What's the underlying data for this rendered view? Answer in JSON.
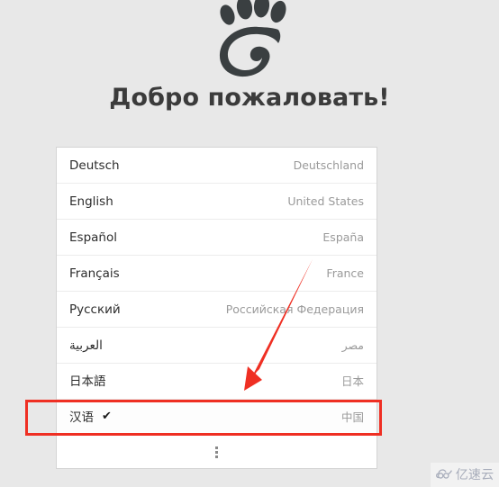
{
  "page": {
    "background_color": "#e8e8e8",
    "logo_name": "gnome-foot-logo",
    "logo_color": "#3a3f41",
    "heading": "Добро пожаловать!"
  },
  "language_list": {
    "rows": [
      {
        "name": "Deutsch",
        "country": "Deutschland",
        "selected": false,
        "rtl": false
      },
      {
        "name": "English",
        "country": "United States",
        "selected": false,
        "rtl": false
      },
      {
        "name": "Español",
        "country": "España",
        "selected": false,
        "rtl": false
      },
      {
        "name": "Français",
        "country": "France",
        "selected": false,
        "rtl": false
      },
      {
        "name": "Русский",
        "country": "Российская Федерация",
        "selected": false,
        "rtl": false
      },
      {
        "name": "العربية",
        "country": "مصر",
        "selected": false,
        "rtl": true
      },
      {
        "name": "日本語",
        "country": "日本",
        "selected": false,
        "rtl": false
      },
      {
        "name": "汉语",
        "country": "中国",
        "selected": true,
        "rtl": false
      }
    ],
    "check_glyph": "✔",
    "more_options": {
      "icon": "vertical-dots-icon",
      "label": ""
    }
  },
  "annotations": {
    "highlight_rect": {
      "color": "#ef2f23",
      "target": "汉语"
    },
    "arrow": {
      "color": "#ef2f23",
      "points_to": "汉语"
    }
  },
  "watermark": {
    "icon": "cloud-logo-icon",
    "text": "亿速云",
    "color": "#a8adbb"
  }
}
